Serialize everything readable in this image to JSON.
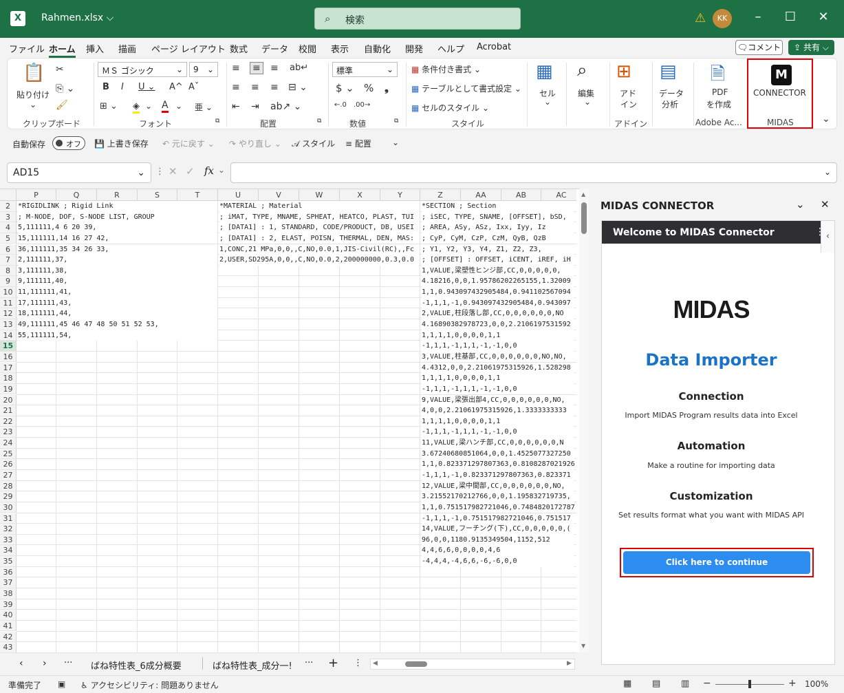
{
  "title": {
    "filename": "Rahmen.xlsx",
    "search": "検索",
    "avatar": "KK"
  },
  "menu": [
    "ファイル",
    "ホーム",
    "挿入",
    "描画",
    "ページ レイアウト",
    "数式",
    "データ",
    "校閲",
    "表示",
    "自動化",
    "開発",
    "ヘルプ",
    "Acrobat"
  ],
  "comment": "コメント",
  "share": "共有",
  "ribbon": {
    "clipboard": {
      "paste": "貼り付け",
      "label": "クリップボード"
    },
    "font": {
      "name": "ＭＳ ゴシック",
      "size": "9",
      "label": "フォント"
    },
    "align": {
      "label": "配置"
    },
    "number": {
      "format": "標準",
      "label": "数値"
    },
    "style": {
      "cond": "条件付き書式",
      "table": "テーブルとして書式設定",
      "cell": "セルのスタイル",
      "label": "スタイル"
    },
    "cells": {
      "btn": "セル"
    },
    "edit": {
      "btn": "編集"
    },
    "addin": {
      "btn1": "アド",
      "btn2": "イン",
      "label": "アドイン"
    },
    "analysis": {
      "btn1": "データ",
      "btn2": "分析"
    },
    "pdf": {
      "btn1": "PDF",
      "btn2": "を作成",
      "label": "Adobe Ac..."
    },
    "midas": {
      "btn": "CONNECTOR",
      "label": "MIDAS"
    }
  },
  "qat": {
    "autosave": "自動保存",
    "off": "オフ",
    "save": "上書き保存",
    "undo": "元に戻す",
    "redo": "やり直し",
    "style": "スタイル",
    "align": "配置"
  },
  "namebox": "AD15",
  "columns": [
    "P",
    "Q",
    "R",
    "S",
    "T",
    "U",
    "V",
    "W",
    "X",
    "Y",
    "Z",
    "AA",
    "AB",
    "AC"
  ],
  "rows": [
    "2",
    "3",
    "4",
    "5",
    "6",
    "7",
    "8",
    "9",
    "10",
    "11",
    "12",
    "13",
    "14",
    "15",
    "16",
    "17",
    "18",
    "19",
    "20",
    "21",
    "22",
    "23",
    "24",
    "25",
    "26",
    "27",
    "28",
    "29",
    "30",
    "31",
    "32",
    "33",
    "34",
    "35",
    "36",
    "37",
    "38",
    "39",
    "40",
    "41",
    "42",
    "43"
  ],
  "colP": [
    "*RIGIDLINK    ; Rigid Link",
    "; M-NODE, DOF, S-NODE LIST, GROUP",
    "5,111111,4 6 20 39,",
    "15,111111,14 16 27 42,",
    "36,111111,35 34 26 33,",
    "2,111111,37,",
    "3,111111,38,",
    "9,111111,40,",
    "11,111111,41,",
    "17,111111,43,",
    "18,111111,44,",
    "49,111111,45 46 47 48 50 51 52 53,",
    "55,111111,54,"
  ],
  "colU": [
    "*MATERIAL    ; Material",
    "; iMAT, TYPE, MNAME, SPHEAT, HEATCO, PLAST, TUI",
    "; [DATA1] : 1, STANDARD, CODE/PRODUCT, DB, USEI",
    "; [DATA1] : 2, ELAST, POISN, THERMAL, DEN, MAS:",
    "1,CONC,21 MPa,0,0,,C,NO,0.0,1,JIS-Civil(RC),,Fc",
    "2,USER,SD295A,0,0,,C,NO,0.0,2,200000000,0.3,0.0"
  ],
  "colZ": [
    "*SECTION    ; Section",
    "; iSEC, TYPE, SNAME, [OFFSET], bSD, ",
    "; AREA, ASy, ASz, Ixx, Iyy, Iz",
    "; CyP, CyM, CzP, CzM, QyB, QzB",
    "; Y1, Y2, Y3, Y4, Z1, Z2, Z3,",
    "; [OFFSET] : OFFSET, iCENT, iREF, iH",
    "1,VALUE,梁塑性ヒンジ部,CC,0,0,0,0,0,",
    "4.18216,0,0,1.95786202265155,1.32009",
    "1,1,0.943097432905484,0.941102567094",
    "-1,1,1,-1,0.943097432905484,0.943097",
    "2,VALUE,柱段落し部,CC,0,0,0,0,0,0,NO",
    "4.16890382978723,0,0,2.2106197531592",
    "1,1,1,1,0,0,0,0,1,1",
    "-1,1,1,-1,1,1,-1,-1,0,0",
    "3,VALUE,柱基部,CC,0,0,0,0,0,0,NO,NO,",
    "4.4312,0,0,2.21061975315926,1.528298",
    "1,1,1,1,0,0,0,0,1,1",
    "-1,1,1,-1,1,1,-1,-1,0,0",
    "9,VALUE,梁張出部4,CC,0,0,0,0,0,0,NO,",
    "4,0,0,2.21061975315926,1.3333333333",
    "1,1,1,1,0,0,0,0,1,1",
    "-1,1,1,-1,1,1,-1,-1,0,0",
    "11,VALUE,梁ハンチ部,CC,0,0,0,0,0,0,N",
    "3.67240680851064,0,0,1.4525077327250",
    "1,1,0.823371297807363,0.8108287021926",
    "-1,1,1,-1,0.823371297807363,0.823371",
    "12,VALUE,梁中間部,CC,0,0,0,0,0,0,NO,",
    "3.21552170212766,0,0,1.195832719735,",
    "1,1,0.751517982721046,0.7484820172787",
    "-1,1,1,-1,0.751517982721046,0.751517",
    "14,VALUE,フーチング(下),CC,0,0,0,0,0,(",
    "96,0,0,1180.9135349504,1152,512",
    "4,4,6,6,0,0,0,0,4,6",
    "-4,4,4,-4,6,6,-6,-6,0,0"
  ],
  "pane": {
    "title": "MIDAS CONNECTOR",
    "header": "Welcome to MIDAS Connector",
    "logo": "MIDAS",
    "heading": "Data Importer",
    "s1_title": "Connection",
    "s1_text": "Import MIDAS Program results data into Excel",
    "s2_title": "Automation",
    "s2_text": "Make a routine for importing data",
    "s3_title": "Customization",
    "s3_text": "Set results format what you want with MIDAS API",
    "button": "Click here to continue"
  },
  "tabs": [
    "ばね特性表_6成分概要",
    "ばね特性表_成分一!"
  ],
  "status": {
    "ready": "準備完了",
    "access": "アクセシビリティ: 問題ありません",
    "zoom": "100%"
  },
  "colors": {
    "excel_green": "#1e7145",
    "accent_blue": "#2d8cf0",
    "highlight_red": "#e00000"
  }
}
